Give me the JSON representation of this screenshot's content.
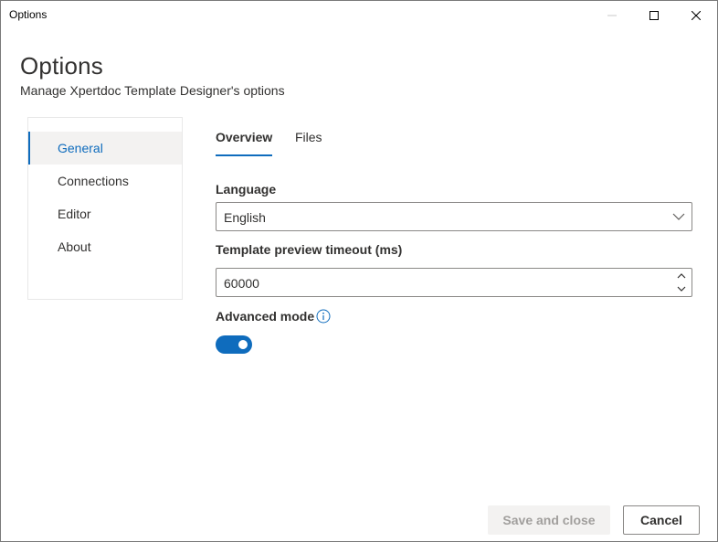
{
  "window": {
    "title": "Options",
    "controls": [
      "minimize-icon",
      "maximize-icon",
      "close-icon"
    ]
  },
  "header": {
    "title": "Options",
    "subtitle": "Manage Xpertdoc Template Designer's options"
  },
  "sidebar": {
    "items": [
      {
        "label": "General",
        "active": true
      },
      {
        "label": "Connections",
        "active": false
      },
      {
        "label": "Editor",
        "active": false
      },
      {
        "label": "About",
        "active": false
      }
    ]
  },
  "tabs": [
    {
      "label": "Overview",
      "active": true
    },
    {
      "label": "Files",
      "active": false
    }
  ],
  "form": {
    "language": {
      "label": "Language",
      "value": "English"
    },
    "timeout": {
      "label": "Template preview timeout (ms)",
      "value": "60000"
    },
    "advanced_mode": {
      "label": "Advanced mode",
      "enabled": true
    }
  },
  "footer": {
    "save_label": "Save and close",
    "cancel_label": "Cancel"
  },
  "colors": {
    "accent": "#0f6cbd",
    "disabled_text": "#a19f9d",
    "disabled_bg": "#f3f2f1"
  }
}
